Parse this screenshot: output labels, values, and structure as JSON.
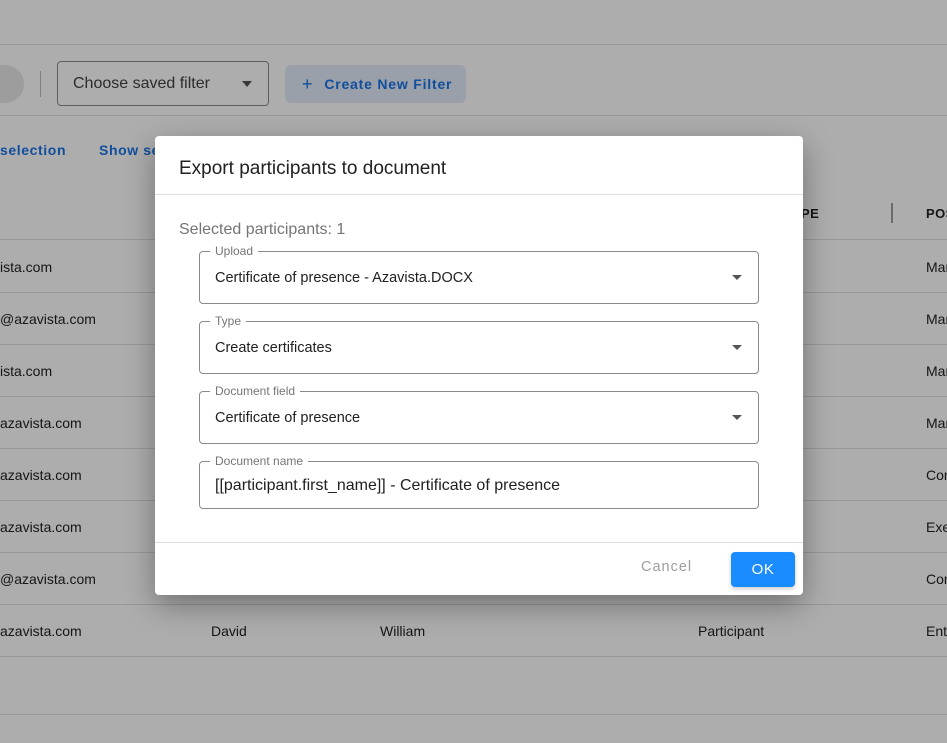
{
  "toolbar": {
    "saved_filter_label": "Choose saved filter",
    "create_filter_label": "Create New Filter",
    "create_filter_icon": "plus-icon"
  },
  "selection_links": {
    "left": "selection",
    "right": "Show se"
  },
  "table": {
    "headers": {
      "type_partial": "PE",
      "position_partial": "POS"
    },
    "rows": [
      {
        "email": "ista.com",
        "first_name": "",
        "last_name": "",
        "type": "",
        "position": "Mar"
      },
      {
        "email": "@azavista.com",
        "first_name": "",
        "last_name": "",
        "type": "",
        "position": "Mar"
      },
      {
        "email": "ista.com",
        "first_name": "",
        "last_name": "",
        "type": "",
        "position": "Mar"
      },
      {
        "email": "azavista.com",
        "first_name": "",
        "last_name": "",
        "type": "",
        "position": "Mar"
      },
      {
        "email": "azavista.com",
        "first_name": "",
        "last_name": "",
        "type": "",
        "position": "Con"
      },
      {
        "email": "azavista.com",
        "first_name": "",
        "last_name": "",
        "type": "",
        "position": "Exe"
      },
      {
        "email": "@azavista.com",
        "first_name": "",
        "last_name": "",
        "type": "",
        "position": "Con"
      },
      {
        "email": "azavista.com",
        "first_name": "David",
        "last_name": "William",
        "type": "Participant",
        "position": "Ent"
      }
    ]
  },
  "dialog": {
    "title": "Export participants to document",
    "selected_count": "Selected participants: 1",
    "fields": {
      "upload": {
        "label": "Upload",
        "value": "Certificate of presence - Azavista.DOCX"
      },
      "type": {
        "label": "Type",
        "value": "Create certificates"
      },
      "document_field": {
        "label": "Document field",
        "value": "Certificate of presence"
      },
      "document_name": {
        "label": "Document name",
        "value": "[[participant.first_name]] - Certificate of presence"
      }
    },
    "cancel_label": "Cancel",
    "ok_label": "OK"
  },
  "colors": {
    "accent": "#1a8cff",
    "link": "#1a73e8",
    "overlay": "rgba(0,0,0,0.32)"
  }
}
